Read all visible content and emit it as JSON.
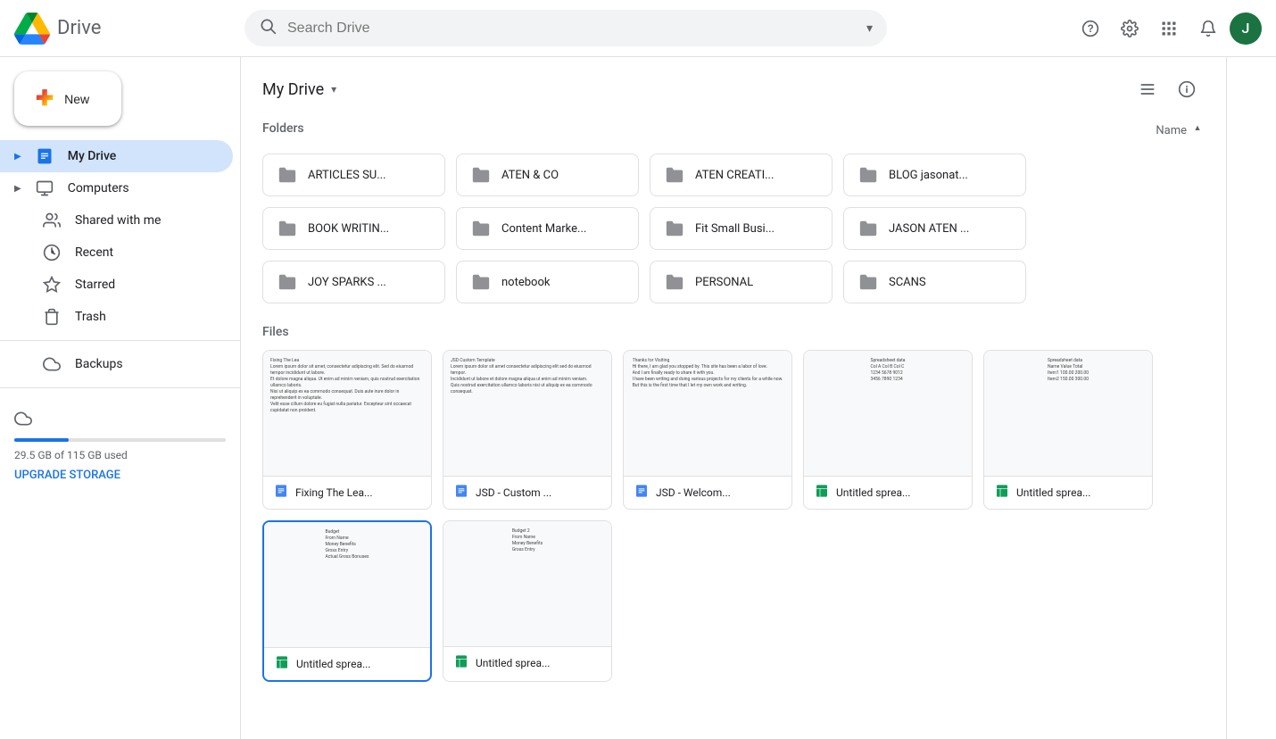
{
  "app": {
    "name": "Drive",
    "logo_alt": "Google Drive Logo"
  },
  "header": {
    "search_placeholder": "Search Drive",
    "help_label": "?",
    "settings_label": "⚙",
    "apps_label": "⊞",
    "notifications_label": "🔔",
    "avatar_initial": "J"
  },
  "sidebar": {
    "new_button_label": "New",
    "items": [
      {
        "id": "my-drive",
        "label": "My Drive",
        "icon": "🗂",
        "active": true
      },
      {
        "id": "computers",
        "label": "Computers",
        "icon": "💻",
        "active": false
      },
      {
        "id": "shared",
        "label": "Shared with me",
        "icon": "👥",
        "active": false
      },
      {
        "id": "recent",
        "label": "Recent",
        "icon": "🕐",
        "active": false
      },
      {
        "id": "starred",
        "label": "Starred",
        "icon": "⭐",
        "active": false
      },
      {
        "id": "trash",
        "label": "Trash",
        "icon": "🗑",
        "active": false
      }
    ],
    "backups_label": "Backups",
    "backups_icon": "☁",
    "storage_label": "29.5 GB of 115 GB used",
    "upgrade_label": "UPGRADE STORAGE"
  },
  "content": {
    "title": "My Drive",
    "sort_label": "Name",
    "folders_section": "Folders",
    "files_section": "Files",
    "folders": [
      {
        "name": "ARTICLES SU..."
      },
      {
        "name": "ATEN & CO"
      },
      {
        "name": "ATEN CREATI..."
      },
      {
        "name": "BLOG jasonat..."
      },
      {
        "name": "BOOK WRITIN..."
      },
      {
        "name": "Content Marke..."
      },
      {
        "name": "Fit Small Busi..."
      },
      {
        "name": "JASON ATEN ..."
      },
      {
        "name": "JOY SPARKS ..."
      },
      {
        "name": "notebook"
      },
      {
        "name": "PERSONAL"
      },
      {
        "name": "SCANS"
      }
    ],
    "files": [
      {
        "name": "Fixing The Lea...",
        "type": "doc",
        "preview_lines": [
          "Fixing The Lea",
          "Lorem ipsum dolor sit amet, consectetur adipiscing elit. Sed do eiusmod tempor incididunt ut labore.",
          "Et dolore magna aliqua. Ut enim ad minim veniam, quis nostrud exercitation ullamco laboris.",
          "Nisi ut aliquip ex ea commodo consequat. Duis aute irure dolor in reprehenderit in voluptate.",
          "Velit esse cillum dolore eu fugiat nulla pariatur. Excepteur sint occaecat cupidatat non proident."
        ],
        "selected": false
      },
      {
        "name": "JSD - Custom ...",
        "type": "doc",
        "preview_lines": [
          "JSD Custom Template",
          "Lorem ipsum dolor sit amet consectetur adipiscing elit sed do eiusmod tempor.",
          "Incididunt ut labore et dolore magna aliqua ut enim ad minim veniam.",
          "Quis nostrud exercitation ullamco laboris nisi ut aliquip ex ea commodo consequat."
        ],
        "selected": false
      },
      {
        "name": "JSD - Welcom...",
        "type": "doc",
        "preview_lines": [
          "Thanks for Visiting",
          "Hi there, I am glad you stopped by. This site has been a labor of love.",
          "And I am finally ready to share it with you.",
          "I have been writing and doing various projects for my clients for a while now.",
          "But this is the first time that I let my own work and writing."
        ],
        "selected": false
      },
      {
        "name": "Untitled sprea...",
        "type": "sheet",
        "preview_lines": [
          "Spreadsheet data",
          "Col A  Col B  Col C",
          "1234   5678   9012",
          "3456   7890   1234"
        ],
        "selected": false
      },
      {
        "name": "Untitled sprea...",
        "type": "sheet",
        "preview_lines": [
          "Spreadsheet data",
          "Name   Value   Total",
          "Item1  100.00  200.00",
          "Item2  150.00  300.00"
        ],
        "selected": false
      },
      {
        "name": "Untitled sprea...",
        "type": "sheet",
        "preview_lines": [
          "Budget",
          "From Name",
          "Money Benefits",
          "Gross Entry",
          "Actual Gross Bonuses",
          ""
        ],
        "selected": true
      },
      {
        "name": "Untitled sprea...",
        "type": "sheet",
        "preview_lines": [
          "Budget 2",
          "From Name",
          "Money Benefits",
          "Gross Entry",
          ""
        ],
        "selected": false
      }
    ]
  },
  "view_toggle": {
    "list_icon": "☰",
    "info_icon": "ℹ"
  }
}
